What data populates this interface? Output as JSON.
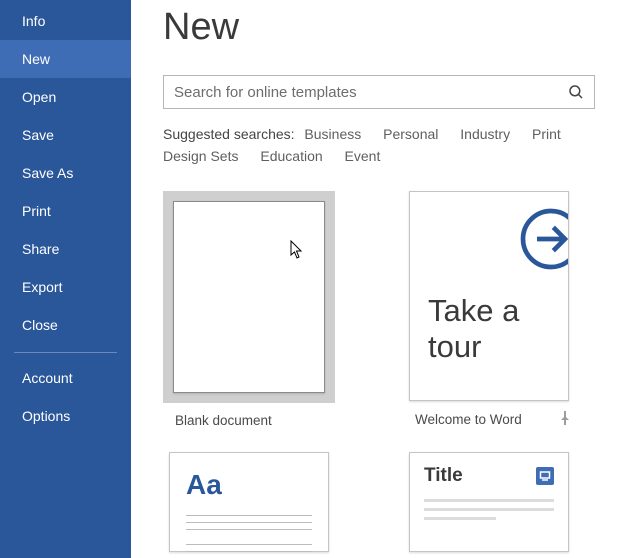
{
  "sidebar": {
    "items": [
      {
        "label": "Info"
      },
      {
        "label": "New"
      },
      {
        "label": "Open"
      },
      {
        "label": "Save"
      },
      {
        "label": "Save As"
      },
      {
        "label": "Print"
      },
      {
        "label": "Share"
      },
      {
        "label": "Export"
      },
      {
        "label": "Close"
      }
    ],
    "footer_items": [
      {
        "label": "Account"
      },
      {
        "label": "Options"
      }
    ],
    "active_index": 1
  },
  "page_title": "New",
  "search": {
    "placeholder": "Search for online templates",
    "value": ""
  },
  "suggested": {
    "label": "Suggested searches:",
    "links": [
      "Business",
      "Personal",
      "Industry",
      "Print",
      "Design Sets",
      "Education",
      "Event"
    ]
  },
  "templates": [
    {
      "label": "Blank document"
    },
    {
      "label": "Welcome to Word",
      "tour_text": "Take a tour",
      "pinned": true
    },
    {
      "aa_text": "Aa"
    },
    {
      "title_head": "Title"
    }
  ]
}
